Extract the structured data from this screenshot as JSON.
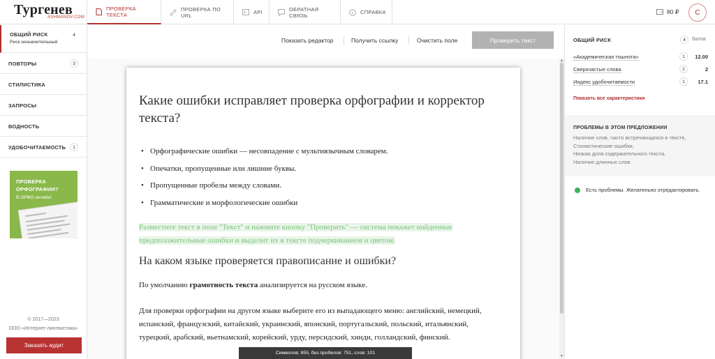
{
  "logo": {
    "title": "Тургенев",
    "subtitle": "ASHMANOV.COM"
  },
  "tabs": [
    {
      "label": "ПРОВЕРКА ТЕКСТА",
      "icon": "document-icon"
    },
    {
      "label": "ПРОВЕРКА ПО URL",
      "icon": "link-icon"
    },
    {
      "label": "API",
      "icon": "api-icon"
    },
    {
      "label": "ОБРАТНАЯ СВЯЗЬ",
      "icon": "chat-icon"
    },
    {
      "label": "СПРАВКА",
      "icon": "info-icon"
    }
  ],
  "account": {
    "balance": "80 ₽",
    "avatar_letter": "С"
  },
  "sidebar": {
    "risk": {
      "label": "ОБЩИЙ РИСК",
      "sub": "Риск незначительный",
      "badge": "4"
    },
    "items": [
      {
        "label": "ПОВТОРЫ",
        "badge": "3"
      },
      {
        "label": "СТИЛИСТИКА",
        "badge": ""
      },
      {
        "label": "ЗАПРОСЫ",
        "badge": ""
      },
      {
        "label": "ВОДНОСТЬ",
        "badge": ""
      },
      {
        "label": "УДОБОЧИТАЕМОСТЬ",
        "badge": "1"
      }
    ],
    "promo": {
      "title_line1": "ПРОВЕРКА",
      "title_line2": "ОРФОГРАФИИ?",
      "sub": "В ОРФО онлайн!"
    },
    "copyright": "© 2017—2023",
    "company": "ООО «Интернет-лингвистика»",
    "audit_button": "Заказать аудит"
  },
  "toolbar": {
    "show_editor": "Показать редактор",
    "get_link": "Получить ссылку",
    "clear": "Очистить поле",
    "check": "Проверить текст"
  },
  "document": {
    "heading": "Какие ошибки исправляет проверка орфографии и корректор текста?",
    "bullets": [
      "Орфографические ошибки — несовпадение с мультиязычным словарем.",
      "Опечатки, пропущенные или лишние буквы.",
      "Пропущенные пробелы между словами.",
      "Грамматические и морфологические ошибки"
    ],
    "highlight": "Разместите текст в поле \"Текст\" и нажмите кнопку \"Проверить\" — система покажет найденные предположительные ошибки и выделит их в тексте подчеркиванием и цветом.",
    "heading2": "На каком языке проверяется правописание и ошибки?",
    "para1_pre": "По умолчанию ",
    "para1_bold": "грамотность текста",
    "para1_post": " анализируется на русском языке.",
    "para2": "Для проверки орфографии на другом языке выберите его из выпадающего меню: английский, немецкий, испанский, французский, китайский, украинский, японский, португальский, польский, итальянский, турецкий, арабский, вьетнамский, корейский, урду, персидский, хинди, голландский, финский."
  },
  "counter": "Символов: 855, без пробелов: 751, слов: 101",
  "right": {
    "risk_label": "ОБЩИЙ РИСК",
    "risk_value": "4",
    "risk_unit": "балла",
    "metrics": [
      {
        "name": "«Академическая тошнота»",
        "count": "1",
        "value": "12.00"
      },
      {
        "name": "Сверхчастые слова",
        "count": "2",
        "value": "2"
      },
      {
        "name": "Индекс удобочитаемости",
        "count": "1",
        "value": "17.1"
      }
    ],
    "show_all": "Показать все характеристики",
    "problems_title": "ПРОБЛЕМЫ В ЭТОМ ПРЕДЛОЖЕНИИ",
    "problems": [
      "Наличие слов, часто встречающихся в тексте,",
      "Стилистические ошибки,",
      "Низкая доля содержательного текста,",
      "Наличие длинных слов"
    ],
    "status_text": "Есть проблемы. Желательно отредактировать.",
    "status_color": "#3cb55a"
  },
  "colors": {
    "accent": "#b03030",
    "promo_bg": "#8ab84a",
    "audit_bg": "#b83232"
  }
}
